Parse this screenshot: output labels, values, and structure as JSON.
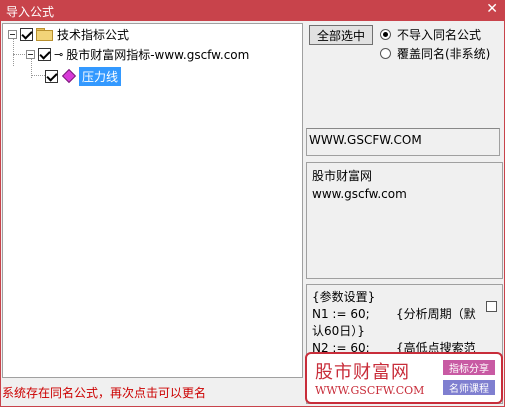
{
  "window": {
    "title": "导入公式",
    "close_glyph": "✕"
  },
  "tree": {
    "root": {
      "label": "技术指标公式",
      "checked": true
    },
    "group": {
      "label": "股市财富网指标-www.gscfw.com",
      "checked": true
    },
    "item": {
      "label": "压力线",
      "checked": true,
      "selected": true
    }
  },
  "controls": {
    "select_all_label": "全部选中",
    "options": [
      {
        "label": "不导入同名公式",
        "selected": true
      },
      {
        "label": "覆盖同名(非系统)",
        "selected": false
      }
    ]
  },
  "url_field": "WWW.GSCFW.COM",
  "description": [
    "股市财富网",
    "www.gscfw.com"
  ],
  "params": [
    "{参数设置}",
    "N1 := 60;",
    "{分析周期（默",
    "认60日）}",
    "N2 := 60;",
    "{高低点搜索范"
  ],
  "status_text": "系统存在同名公式，再次点击可以更名",
  "watermark": {
    "name": "股市财富网",
    "site": "WWW.GSCFW.COM",
    "tag1": "指标分享",
    "tag2": "名师课程"
  },
  "colors": {
    "titlebar": "#c8434b",
    "selection": "#3399ff",
    "status": "#cc0000",
    "watermark": "#c82d3a"
  }
}
